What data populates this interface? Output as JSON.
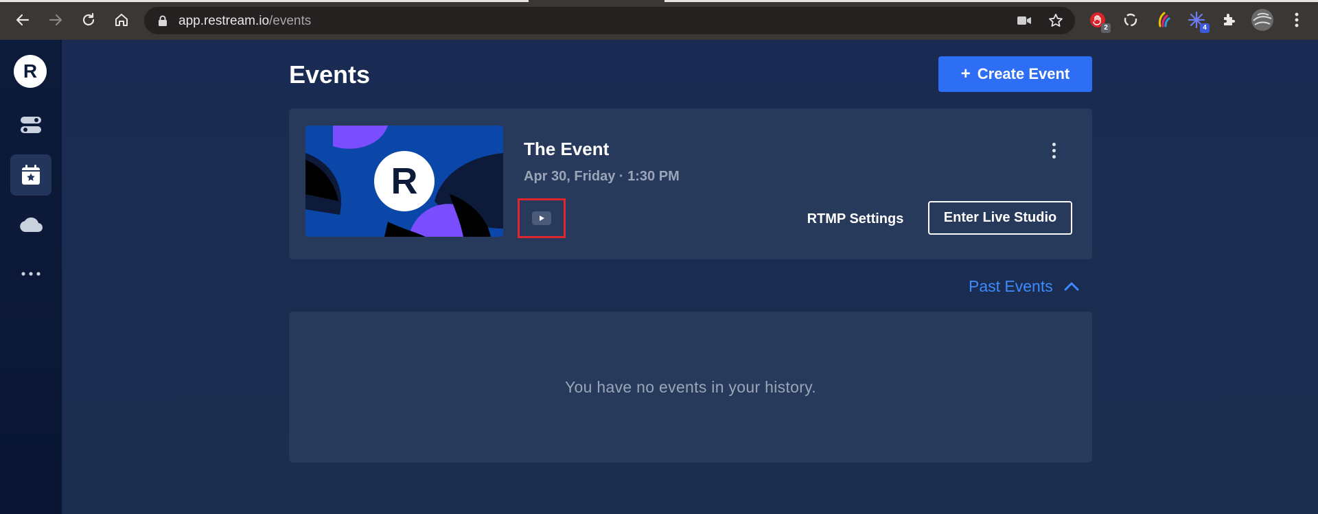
{
  "browser": {
    "url_domain": "app.restream.io",
    "url_path": "/events",
    "extensions": [
      {
        "icon": "hand-stop-extension-icon",
        "badge": "2",
        "badge_color": "#5f6368"
      },
      {
        "icon": "sync-extension-icon",
        "badge": ""
      },
      {
        "icon": "color-picker-extension-icon",
        "badge": ""
      },
      {
        "icon": "burst-extension-icon",
        "badge": "4",
        "badge_color": "#3b5bdb"
      },
      {
        "icon": "puzzle-extensions-icon",
        "badge": ""
      },
      {
        "icon": "profile-avatar-icon",
        "badge": ""
      }
    ]
  },
  "sidebar": {
    "logo_letter": "R",
    "items": [
      {
        "icon": "toggles-icon",
        "active": false
      },
      {
        "icon": "calendar-star-icon",
        "active": true
      },
      {
        "icon": "cloud-icon",
        "active": false
      },
      {
        "icon": "more-dots-icon",
        "active": false
      }
    ]
  },
  "main": {
    "title": "Events",
    "create_button": {
      "plus": "+",
      "label": "Create Event"
    },
    "event": {
      "thumbnail_letter": "R",
      "title": "The Event",
      "date": "Apr 30, Friday · 1:30 PM",
      "platform_icon": "youtube-play-icon",
      "rtmp_label": "RTMP Settings",
      "studio_label": "Enter Live Studio"
    },
    "past_events": {
      "label": "Past Events",
      "expanded": true
    },
    "history_empty": "You have no events in your history."
  },
  "colors": {
    "accent": "#2d6ef5",
    "link": "#3d8bff",
    "card": "#283a5c",
    "highlight": "#e0262e"
  }
}
